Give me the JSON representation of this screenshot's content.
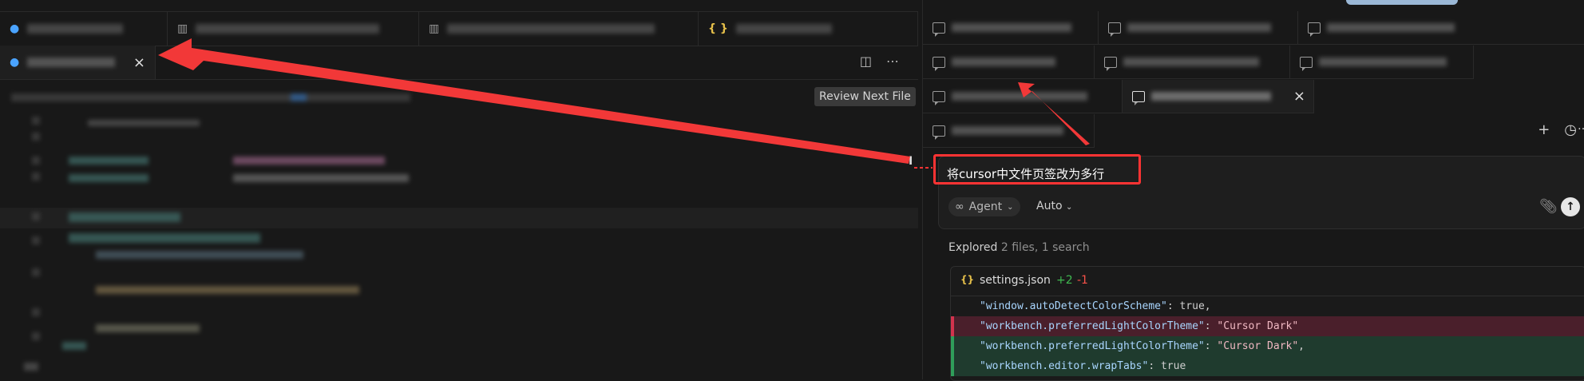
{
  "left_pane": {
    "active_tab_close": "×",
    "review_button_label": "Review Next File",
    "cursor_glyph": "I"
  },
  "chat": {
    "prompt_text": "将cursor中文件页签改为多行",
    "agent_label": "Agent",
    "model_label": "Auto",
    "explored": {
      "bold": "Explored",
      "rest": "2 files, 1 search"
    },
    "diff_file": {
      "icon": "{}",
      "name": "settings.json",
      "added": "+2",
      "removed": "-1",
      "lines": [
        {
          "type": "ctx",
          "key": "\"window.autoDetectColorScheme\"",
          "sep": ": ",
          "value": "true",
          "tail": ","
        },
        {
          "type": "del",
          "key": "\"workbench.preferredLightColorTheme\"",
          "sep": ": ",
          "value": "\"Cursor Dark\"",
          "tail": ""
        },
        {
          "type": "add",
          "key": "\"workbench.preferredLightColorTheme\"",
          "sep": ": ",
          "value": "\"Cursor Dark\"",
          "tail": ","
        },
        {
          "type": "add",
          "key": "\"workbench.editor.wrapTabs\"",
          "sep": ": ",
          "value": "true",
          "tail": ""
        }
      ]
    }
  },
  "colors": {
    "annotation_red": "#ff3333",
    "diff_removed": "#4a1f2b",
    "diff_added": "#1f3b2e",
    "added_count": "#3fb950",
    "removed_count": "#f85149"
  }
}
